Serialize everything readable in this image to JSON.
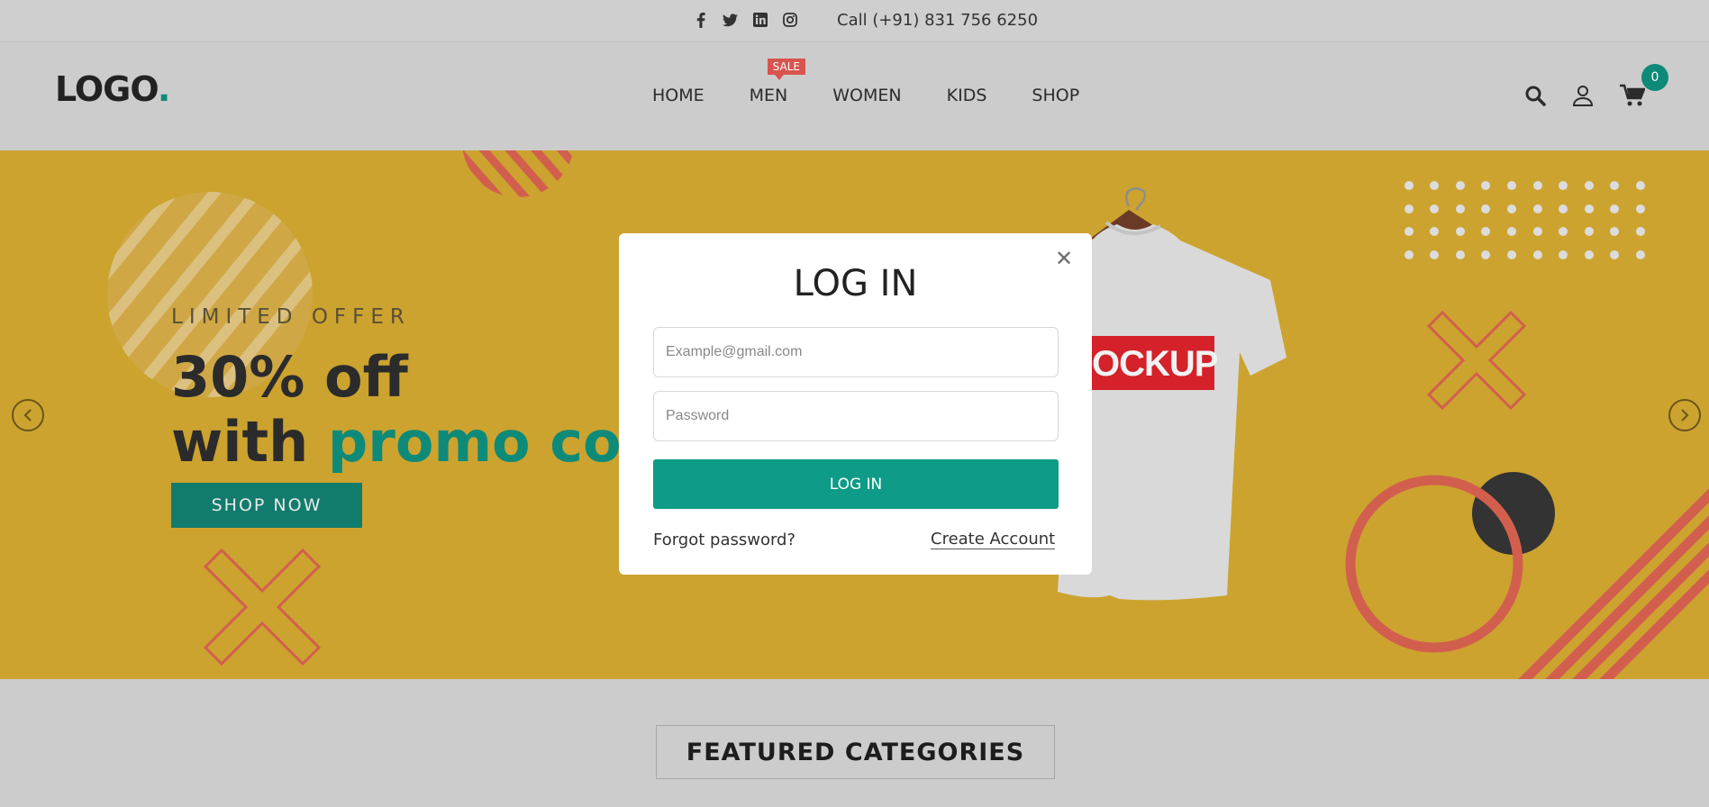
{
  "topbar": {
    "socials": [
      "facebook-icon",
      "twitter-icon",
      "linkedin-icon",
      "instagram-icon"
    ],
    "phone": "Call (+91) 831 756 6250"
  },
  "header": {
    "logo_text": "LOGO",
    "logo_dot": ".",
    "nav": [
      {
        "label": "HOME"
      },
      {
        "label": "MEN",
        "badge": "SALE"
      },
      {
        "label": "WOMEN"
      },
      {
        "label": "KIDS"
      },
      {
        "label": "SHOP"
      }
    ],
    "icons": [
      "search-icon",
      "user-icon",
      "cart-icon"
    ],
    "cart_count": "0"
  },
  "hero": {
    "eyebrow": "LIMITED OFFER",
    "headline_line1": "30% off",
    "headline_line2_prefix": "with ",
    "headline_line2_highlight": "promo cod",
    "cta": "SHOP NOW",
    "product_text": "OCKUP"
  },
  "featured": {
    "title": "FEATURED CATEGORIES"
  },
  "modal": {
    "title": "LOG IN",
    "email_placeholder": "Example@gmail.com",
    "password_placeholder": "Password",
    "submit": "LOG IN",
    "forgot": "Forgot password?",
    "create": "Create Account"
  },
  "colors": {
    "accent": "#0e8a78",
    "hero_bg": "#cca32f",
    "sale": "#d9534f"
  }
}
